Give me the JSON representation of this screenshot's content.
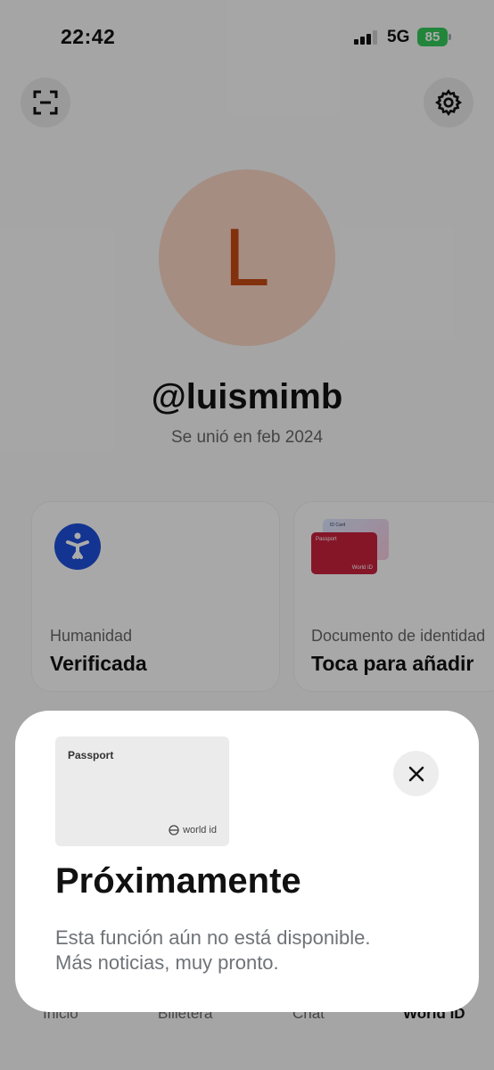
{
  "status": {
    "time": "22:42",
    "network": "5G",
    "battery": "85"
  },
  "profile": {
    "avatar_letter": "L",
    "username": "@luismimb",
    "joined": "Se unió en feb 2024"
  },
  "cards": [
    {
      "label": "Humanidad",
      "value": "Verificada",
      "icon": "person-icon"
    },
    {
      "label": "Documento de identidad",
      "value": "Toca para añadir",
      "icon": "id-card-icon",
      "mini_card_back": "ID Card",
      "mini_card_front": "Passport",
      "mini_card_brand": "World ID"
    }
  ],
  "tabs": [
    "Inicio",
    "Billetera",
    "Chat",
    "World ID"
  ],
  "sheet": {
    "passport_label": "Passport",
    "passport_brand": "world id",
    "title": "Próximamente",
    "description": "Esta función aún no está disponible.\nMás noticias, muy pronto."
  },
  "colors": {
    "avatar_bg": "#f6d2c2",
    "avatar_letter": "#c24a12",
    "human_icon": "#1f4ed8",
    "id_card": "#c7213d",
    "battery": "#34c759"
  }
}
